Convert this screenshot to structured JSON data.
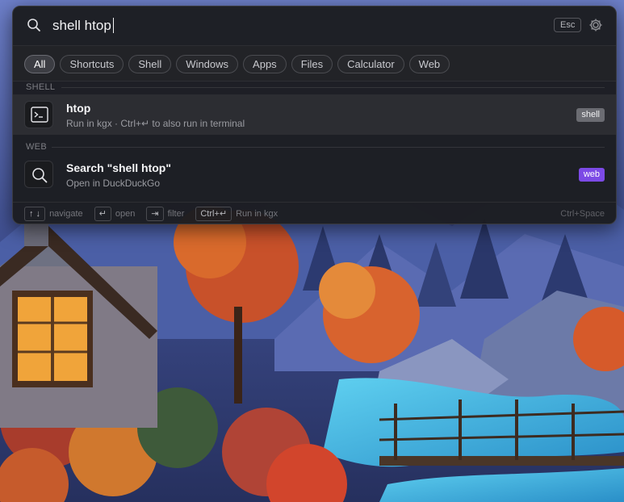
{
  "search": {
    "value": "shell htop",
    "escape_label": "Esc",
    "search_icon": "search-icon",
    "settings_icon": "gear-icon"
  },
  "filters": [
    {
      "label": "All",
      "active": true
    },
    {
      "label": "Shortcuts",
      "active": false
    },
    {
      "label": "Shell",
      "active": false
    },
    {
      "label": "Windows",
      "active": false
    },
    {
      "label": "Apps",
      "active": false
    },
    {
      "label": "Files",
      "active": false
    },
    {
      "label": "Calculator",
      "active": false
    },
    {
      "label": "Web",
      "active": false
    }
  ],
  "sections": [
    {
      "label": "SHELL",
      "results": [
        {
          "title": "htop",
          "subtitle": "Run in kgx · Ctrl+↵ to also run in terminal",
          "badge": "shell",
          "icon": "terminal-icon",
          "selected": true
        }
      ]
    },
    {
      "label": "WEB",
      "results": [
        {
          "title": "Search \"shell htop\"",
          "subtitle": "Open in DuckDuckGo",
          "badge": "web",
          "icon": "search-icon",
          "selected": false
        }
      ]
    }
  ],
  "footer": {
    "hints": [
      {
        "key": "↑ ↓",
        "label": "navigate"
      },
      {
        "key": "↵",
        "label": "open"
      },
      {
        "key": "⇥",
        "label": "filter"
      },
      {
        "key": "Ctrl+↵",
        "label": "Run in kgx"
      }
    ],
    "toggle_shortcut": "Ctrl+Space"
  },
  "colors": {
    "panel_bg": "#1c1d21",
    "shell_badge": "#6b6c72",
    "web_badge": "#7c4ae6",
    "selected_row": "#2c2d32"
  }
}
